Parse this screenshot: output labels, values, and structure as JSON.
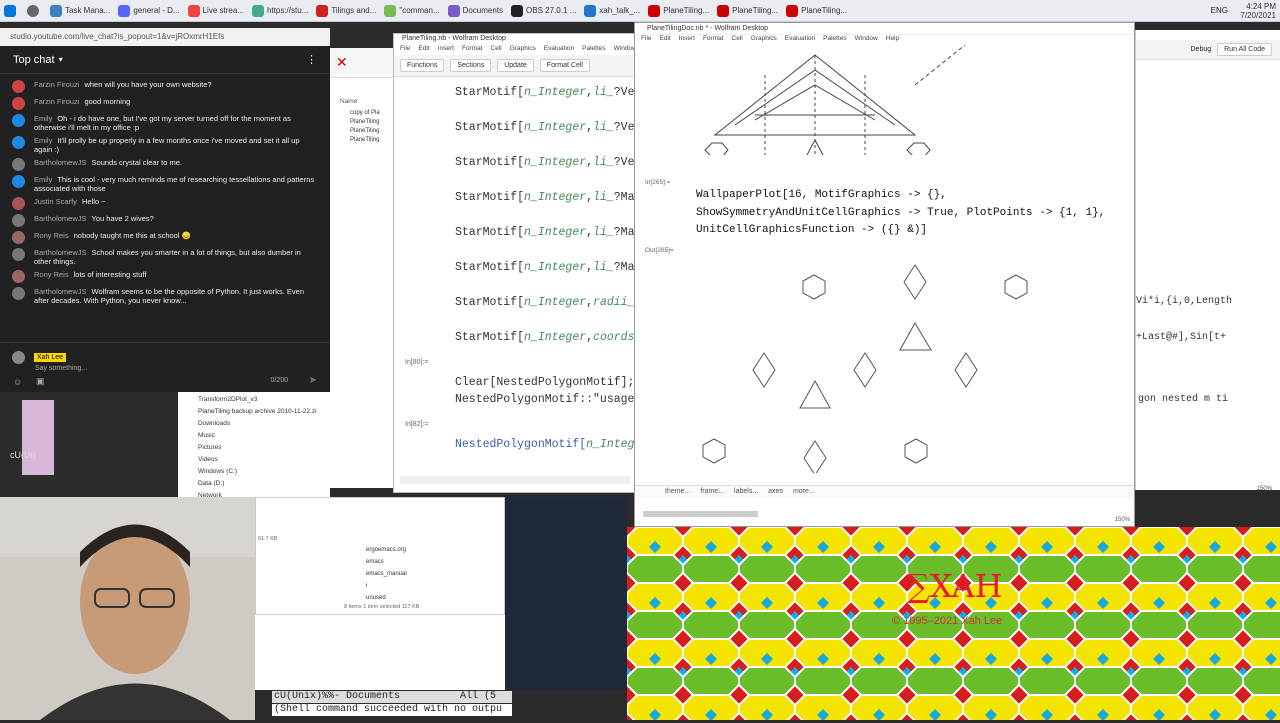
{
  "taskbar": {
    "items": [
      {
        "label": "Task Mana...",
        "color": "#3f7fbf"
      },
      {
        "label": "general - D...",
        "color": "#5865f2"
      },
      {
        "label": "Live strea...",
        "color": "#e44"
      },
      {
        "label": "https://stu...",
        "color": "#4a8"
      },
      {
        "label": "Tilings and...",
        "color": "#c22"
      },
      {
        "label": "\"comman...",
        "color": "#7b5"
      },
      {
        "label": "Documents",
        "color": "#7c5cc4"
      },
      {
        "label": "OBS 27.0.1 ...",
        "color": "#222"
      },
      {
        "label": "xah_talk_...",
        "color": "#2277cc"
      },
      {
        "label": "PlaneTiling...",
        "color": "#c00"
      },
      {
        "label": "PlaneTiling...",
        "color": "#c00"
      },
      {
        "label": "PlaneTiling...",
        "color": "#c00"
      }
    ],
    "clock_time": "4:24 PM",
    "clock_date": "7/20/2021",
    "lang": "ENG"
  },
  "chat": {
    "url": "studio.youtube.com/live_chat?is_popout=1&v=jROxmrH1Efs",
    "title": "Top chat",
    "messages": [
      {
        "author": "Farzin Firouzi",
        "text": "when will you have your own website?",
        "color": "#c44"
      },
      {
        "author": "Farzin Firouzi",
        "text": "good morning",
        "color": "#c44"
      },
      {
        "author": "Emily",
        "text": "Oh - i do have one, but I've got my server turned off for the moment as otherwise i'll melt in my office :p",
        "color": "#1e88e5"
      },
      {
        "author": "Emily",
        "text": "It'll prolly be up properly in a few months once i've moved and set it all up again :)",
        "color": "#1e88e5"
      },
      {
        "author": "BartholomewJS",
        "text": "Sounds crystal clear to me.",
        "color": "#777"
      },
      {
        "author": "Emily",
        "text": "This is cool - very much reminds me of researching tessellations and patterns associated with those",
        "color": "#1e88e5"
      },
      {
        "author": "Justin Scarfy",
        "text": "Hello ~",
        "color": "#a55"
      },
      {
        "author": "BartholomewJS",
        "text": "You have 2 wives?",
        "color": "#777"
      },
      {
        "author": "Rony Reis",
        "text": "nobody taught me this at school 😞",
        "color": "#966"
      },
      {
        "author": "BartholomewJS",
        "text": "School makes you smarter in a lot of things, but also dumber in other things.",
        "color": "#777"
      },
      {
        "author": "Rony Reis",
        "text": "lots of interesting stuff",
        "color": "#966"
      },
      {
        "author": "BartholomewJS",
        "text": "Wolfram seems to be the opposite of Python. It just works. Even after decades. With Python, you never know...",
        "color": "#777"
      }
    ],
    "user": "Xah Lee",
    "placeholder": "Say something...",
    "counter": "0/200"
  },
  "explorer": {
    "name_header": "Name",
    "files": [
      "copy of Pla",
      "PlaneTiling",
      "PlaneTiling",
      "PlaneTiling"
    ],
    "bottom_items": [
      "Transform2DPlot_v3",
      "PlaneTiling backup archive 2010-11-22.zi",
      "Downloads",
      "Music",
      "Pictures",
      "Videos",
      "Windows (C:)",
      "Data (D:)",
      "Network"
    ],
    "folders2": [
      "ergoemacs.org",
      "emacs",
      "emacs_manual",
      "i",
      "unused"
    ],
    "status2": "8 items   1 item selected  117 KB",
    "size_note": "61.7 KB"
  },
  "nb1": {
    "title": "PlaneTiling.nb - Wolfram Desktop",
    "menu": [
      "File",
      "Edit",
      "Insert",
      "Format",
      "Cell",
      "Graphics",
      "Evaluation",
      "Palettes",
      "Window",
      "Help"
    ],
    "tools": [
      "Functions",
      "Sections",
      "Update",
      "Format Cell"
    ],
    "lines": [
      {
        "pre": "StarMotif[",
        "it": "n_Integer",
        "mid": ",",
        "it2": "li_",
        "post": "?Vec"
      },
      {
        "pre": "StarMotif[",
        "it": "n_Integer",
        "mid": ",",
        "it2": "li_",
        "post": "?Vec"
      },
      {
        "pre": "StarMotif[",
        "it": "n_Integer",
        "mid": ",",
        "it2": "li_",
        "post": "?Vec"
      },
      {
        "pre": "StarMotif[",
        "it": "n_Integer",
        "mid": ",",
        "it2": "li_",
        "post": "?Mat"
      },
      {
        "pre": "StarMotif[",
        "it": "n_Integer",
        "mid": ",",
        "it2": "li_",
        "post": "?Mat"
      },
      {
        "pre": "StarMotif[",
        "it": "n_Integer",
        "mid": ",",
        "it2": "li_",
        "post": "?Mat"
      },
      {
        "pre": "StarMotif[",
        "it": "n_Integer",
        "mid": ",",
        "it2": "radii_",
        "post": "?"
      },
      {
        "pre": "StarMotif[",
        "it": "n_Integer",
        "mid": ",",
        "it2": "coords_",
        "post": ""
      }
    ],
    "in80": "In[80]:=",
    "clear": "Clear[NestedPolygonMotif];",
    "usage": "NestedPolygonMotif::\"usage\"=",
    "in82": "In[82]:=",
    "nested": "NestedPolygonMotif[",
    "nested_it": "n_Integer"
  },
  "nb2": {
    "title": "PlaneTilingDoc.nb * - Wolfram Desktop",
    "menu": [
      "File",
      "Edit",
      "Insert",
      "Format",
      "Cell",
      "Graphics",
      "Evaluation",
      "Palettes",
      "Window",
      "Help"
    ],
    "in_label": "In[265]:=",
    "out_label": "Out[265]=",
    "code1": "WallpaperPlot[16, MotifGraphics -> {},",
    "code2": " ShowSymmetryAndUnitCellGraphics -> True, PlotPoints -> {1, 1},",
    "code3": " UnitCellGraphicsFunction -> ({} &)]",
    "bar": [
      "theme...",
      "frame...",
      "labels...",
      "axes",
      "more..."
    ],
    "zoom": "150%"
  },
  "right": {
    "debug": "Debug",
    "run": "Run All Code",
    "code1": "Vi*i,{i,0,Length",
    "code2": "+Last@#],Sin[t+",
    "code3": "gon nested m ti",
    "zoom": "150%"
  },
  "emacs": {
    "mode": "cU(Unix)%%-  Documents",
    "pos": "All (5",
    "msg": "(Shell command succeeded with no outpu",
    "side": "cU(Un"
  },
  "watermark": {
    "name": "∑XAH",
    "copy": "© 1995–2021 Xah Lee"
  },
  "colors": {
    "chat_bg": "#212121",
    "tile_yellow": "#f5e400",
    "tile_green": "#6bbd2a",
    "tile_red": "#d81d1d",
    "tile_blue": "#18a8e0"
  }
}
